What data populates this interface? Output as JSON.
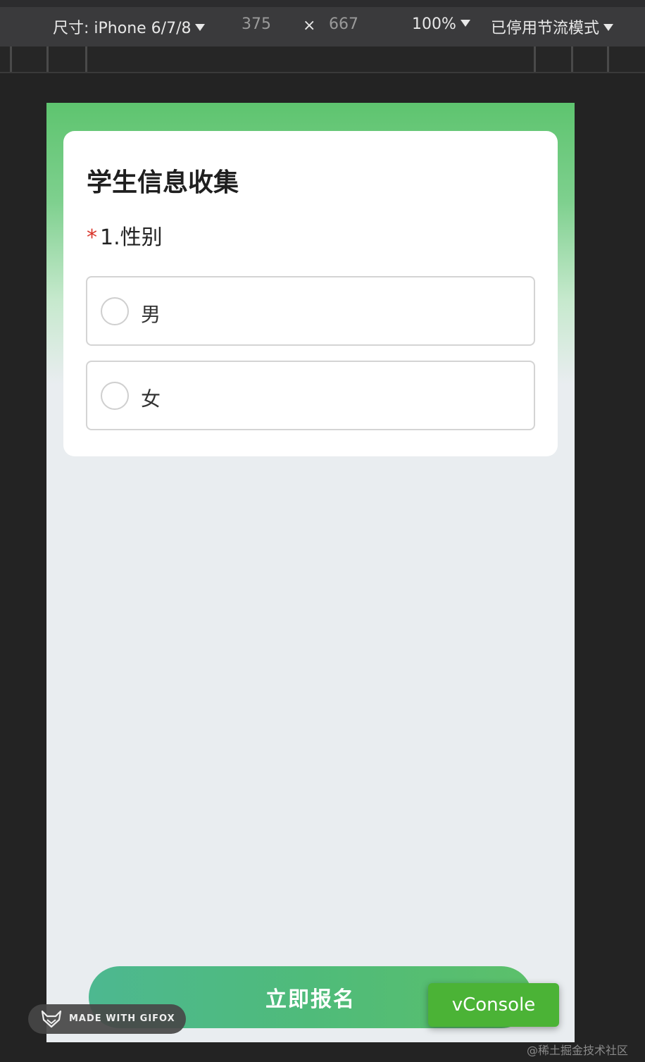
{
  "devtools": {
    "device_label": "尺寸: iPhone 6/7/8",
    "width": "375",
    "times": "×",
    "height": "667",
    "zoom": "100%",
    "throttle": "已停用节流模式"
  },
  "form": {
    "title": "学生信息收集",
    "question": {
      "required_mark": "*",
      "label": "1.性别",
      "options": [
        {
          "label": "男",
          "selected": false
        },
        {
          "label": "女",
          "selected": false
        }
      ]
    },
    "submit_label": "立即报名"
  },
  "vconsole": {
    "label": "vConsole"
  },
  "overlay": {
    "gifox_label": "MADE WITH GIFOX",
    "watermark": "@稀土掘金技术社区"
  },
  "colors": {
    "header_green": "#5ec46f",
    "button_green": "#4fbb7a",
    "vconsole_green": "#4bb336",
    "required_red": "#d9362b",
    "page_bg": "#e9edf0"
  }
}
